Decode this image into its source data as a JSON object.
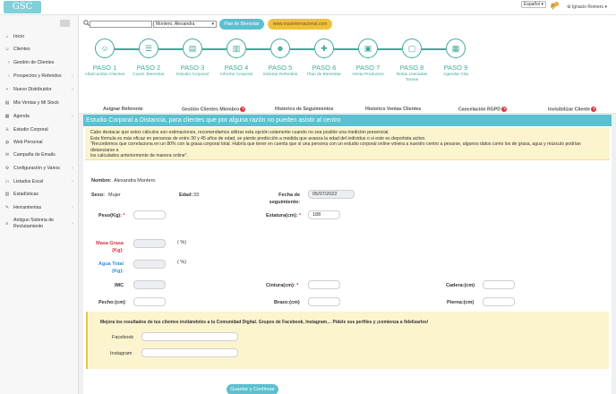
{
  "app": {
    "logo": "GSC",
    "language": "Español",
    "notification_count": "0",
    "user_name": "Ignacio Romero"
  },
  "sidebar": {
    "items": [
      {
        "icon": "home-icon",
        "label": "Inicio",
        "chevron": false
      },
      {
        "icon": "users-icon",
        "label": "Clientes",
        "chevron": false
      },
      {
        "icon": "chevron-right-icon",
        "label": "Gestión de Clientes",
        "chevron": false
      },
      {
        "icon": "chevron-right-icon",
        "label": "Prospectos y Referidos",
        "chevron": true
      },
      {
        "icon": "user-plus-icon",
        "label": "Nuevo Distribuidor",
        "chevron": true
      },
      {
        "icon": "chart-icon",
        "label": "Mis Ventas y Mi Stock",
        "chevron": false
      },
      {
        "icon": "calendar-icon",
        "label": "Agenda",
        "chevron": true
      },
      {
        "icon": "body-icon",
        "label": "Estudio Corporal",
        "chevron": false
      },
      {
        "icon": "globe-icon",
        "label": "Web Personal",
        "chevron": false
      },
      {
        "icon": "mail-icon",
        "label": "Campaña de Emails",
        "chevron": false
      },
      {
        "icon": "gear-icon",
        "label": "Configuración y Varios",
        "chevron": true
      },
      {
        "icon": "file-icon",
        "label": "Listados Excel",
        "chevron": true
      },
      {
        "icon": "stats-icon",
        "label": "Estadísticas",
        "chevron": false
      },
      {
        "icon": "wrench-icon",
        "label": "Herramientas",
        "chevron": true
      },
      {
        "icon": "list-icon",
        "label": "Antiguo Sistema de Reclutamiento",
        "chevron": true
      }
    ]
  },
  "toolbar": {
    "search_value": "",
    "client_select": "Montero, Alexandra",
    "plan_button": "Plan de Bienestar",
    "web_button": "www.maxinternacional.com"
  },
  "steps": [
    {
      "title": "PASO 1",
      "sub": "Alta/Cambio Clientes"
    },
    {
      "title": "PASO 2",
      "sub": "Cuest. Bienestar"
    },
    {
      "title": "PASO 3",
      "sub": "Estudio Corporal"
    },
    {
      "title": "PASO 4",
      "sub": "Informe Corporal"
    },
    {
      "title": "PASO 5",
      "sub": "Solicitar Referidos"
    },
    {
      "title": "PASO 6",
      "sub": "Plan de Bienestar"
    },
    {
      "title": "PASO 7",
      "sub": "Venta Productos"
    },
    {
      "title": "PASO 8",
      "sub": "Notas Llamadas Tareas"
    },
    {
      "title": "PASO 9",
      "sub": "Agendar Cita"
    }
  ],
  "tabs": [
    {
      "label": "Asignar Referente",
      "help": false
    },
    {
      "label": "Gestión Clientes Miembro",
      "help": true
    },
    {
      "label": "Historico de Seguimientos",
      "help": false
    },
    {
      "label": "Historico Ventas Clientes",
      "help": false
    },
    {
      "label": "Cancelación RGPD",
      "help": true
    },
    {
      "label": "Invisibilizar Cliente",
      "help": true
    }
  ],
  "card": {
    "title": "Estudio Corporal a Distancia, para clientes que por alguna razón no pueden asistir al centro",
    "warning": [
      "Cabe destacar que estos cálculos son estimaciones, recomendamos utilizar esta opción solamente cuando no sea posible una medición presencial.",
      "Esta fórmula es más eficaz en personas de entre 30 y 45 años de edad, se pierde predicción a medida que avanza la edad del individuo o si este es deportista activo.",
      "\"Recordemos que correlaciona en un 80% con la grasa corporal total. Habría que tener en cuenta que si una persona con un estudio corporal online viniera a nuestro centro a pesarse, algunos datos como los de grasa, agua y músculo podrían distanciarse a",
      "los calculados anteriormente de manera online\"."
    ]
  },
  "form": {
    "name_label": "Nombre:",
    "name_value": "Alexandra Montero",
    "sex_label": "Sexo:",
    "sex_value": "Mujer",
    "age_label": "Edad:",
    "age_value": "33",
    "date_label": "Fecha de seguimiento:",
    "date_value": "05/07/2022",
    "weight_label": "Peso(Kg):",
    "height_label": "Estatura(cm):",
    "height_value": "188",
    "fat_label": "Masa Grasa (Kg):",
    "fat_unit": "( %)",
    "water_label": "Agua Total (Kg):",
    "water_unit": "( %)",
    "imc_label": "IMC",
    "waist_label": "Cintura(cm):",
    "hip_label": "Cadera:(cm)",
    "chest_label": "Pecho:(cm)",
    "arm_label": "Brazo:(cm)",
    "leg_label": "Pierna:(cm)",
    "req": "*"
  },
  "social": {
    "heading": "Mejora los resultados de tus clientes invitándoles a tu Comunidad Digital. Grupos de Facebook, Instagram… Pídele sus perfiles y ¡comienza a fidelizarles!",
    "facebook_label": "Facebook",
    "instagram_label": "Instagram"
  },
  "save_button": "Guardar y Continuar",
  "colors": {
    "accent": "#5bc0cf",
    "step": "#3fa99a",
    "warning_bg": "#fcf4cf",
    "fat_label": "#d9333f",
    "water_label": "#2f8fd0",
    "web_button": "#efc13a"
  }
}
